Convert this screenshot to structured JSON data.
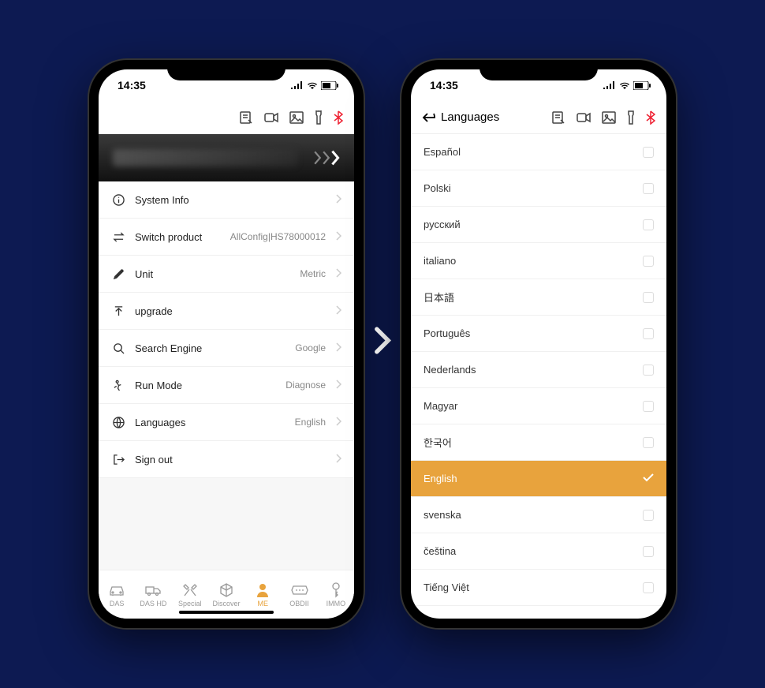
{
  "status": {
    "time": "14:35"
  },
  "toolbar": {
    "icons": [
      "note-icon",
      "video-icon",
      "image-icon",
      "flashlight-icon",
      "bluetooth-icon"
    ]
  },
  "settings_header": {
    "blurred": true
  },
  "settings": [
    {
      "icon": "info-icon",
      "label": "System Info",
      "value": ""
    },
    {
      "icon": "switch-icon",
      "label": "Switch product",
      "value": "AllConfig|HS78000012"
    },
    {
      "icon": "ruler-icon",
      "label": "Unit",
      "value": "Metric"
    },
    {
      "icon": "upgrade-icon",
      "label": "upgrade",
      "value": ""
    },
    {
      "icon": "search-icon",
      "label": "Search Engine",
      "value": "Google"
    },
    {
      "icon": "run-icon",
      "label": "Run Mode",
      "value": "Diagnose"
    },
    {
      "icon": "globe-icon",
      "label": "Languages",
      "value": "English"
    },
    {
      "icon": "signout-icon",
      "label": "Sign out",
      "value": ""
    }
  ],
  "tabs": [
    {
      "label": "DAS",
      "icon": "car-icon"
    },
    {
      "label": "DAS HD",
      "icon": "truck-icon"
    },
    {
      "label": "Special",
      "icon": "tools-icon"
    },
    {
      "label": "Discover",
      "icon": "cube-icon"
    },
    {
      "label": "ME",
      "icon": "person-icon",
      "active": true
    },
    {
      "label": "OBDII",
      "icon": "obd-icon"
    },
    {
      "label": "IMMO",
      "icon": "key-icon"
    }
  ],
  "languages_title": "Languages",
  "languages": [
    {
      "name": "Español"
    },
    {
      "name": "Polski"
    },
    {
      "name": "русский"
    },
    {
      "name": "italiano"
    },
    {
      "name": "日本語"
    },
    {
      "name": "Português"
    },
    {
      "name": "Nederlands"
    },
    {
      "name": "Magyar"
    },
    {
      "name": "한국어"
    },
    {
      "name": "English",
      "selected": true
    },
    {
      "name": "svenska"
    },
    {
      "name": "čeština"
    },
    {
      "name": "Tiếng Việt"
    }
  ]
}
